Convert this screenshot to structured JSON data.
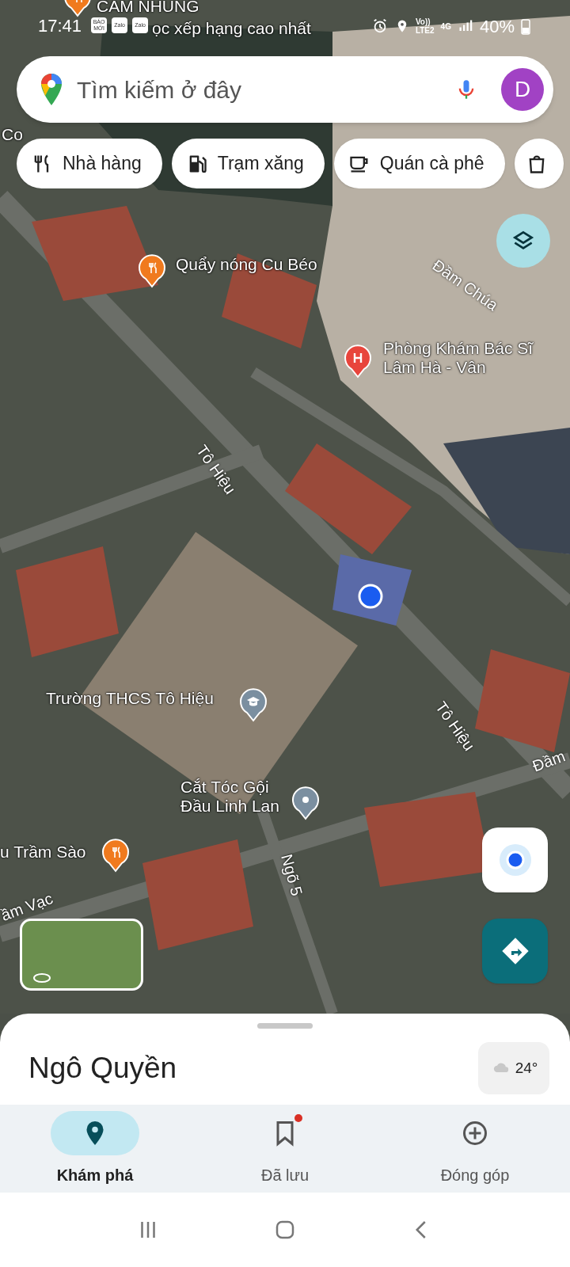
{
  "status_bar": {
    "time": "17:41",
    "notification_apps": [
      "BÁO MỚI",
      "Zalo",
      "Zalo"
    ],
    "network": [
      "Vo))",
      "LTE2",
      "4G"
    ],
    "battery": "40%"
  },
  "search": {
    "placeholder": "Tìm kiếm ở đây",
    "avatar": "D"
  },
  "category_chips": [
    {
      "kind": "restaurant",
      "label": "Nhà hàng"
    },
    {
      "kind": "gas",
      "label": "Trạm xăng"
    },
    {
      "kind": "coffee",
      "label": "Quán cà phê"
    },
    {
      "kind": "shopping"
    }
  ],
  "map_labels": [
    {
      "kind": "restaurant",
      "text": "CAM NHUNG"
    },
    {
      "kind": "label",
      "text": "ọc xếp hạng cao nhất"
    },
    {
      "kind": "label",
      "text": "Co"
    },
    {
      "kind": "restaurant",
      "text": "Quẩy nóng Cu Béo"
    },
    {
      "kind": "road",
      "text": "Đầm Chúa"
    },
    {
      "kind": "hospital",
      "text": "Phòng Khám Bác Sĩ Lâm Hà - Vân"
    },
    {
      "kind": "road",
      "text": "Tô Hiệu"
    },
    {
      "kind": "road",
      "text": "Tô Hiệu"
    },
    {
      "kind": "school",
      "text": "Trường THCS Tô Hiệu"
    },
    {
      "kind": "road",
      "text": "Đầm"
    },
    {
      "kind": "place",
      "text": "Cắt Tóc Gội Đầu Linh Lan"
    },
    {
      "kind": "restaurant",
      "text": "u Trầm Sào"
    },
    {
      "kind": "road",
      "text": "Ngõ 5"
    },
    {
      "kind": "road",
      "text": "ầm Vạc"
    }
  ],
  "sheet": {
    "title": "Ngô Quyền",
    "weather": "24°"
  },
  "bottom_nav": [
    {
      "kind": "explore",
      "label": "Khám phá",
      "selected": true,
      "new_badge": false
    },
    {
      "kind": "saved",
      "label": "Đã lưu",
      "selected": false,
      "new_badge": true
    },
    {
      "kind": "contribute",
      "label": "Đóng góp",
      "selected": false,
      "new_badge": false
    }
  ]
}
